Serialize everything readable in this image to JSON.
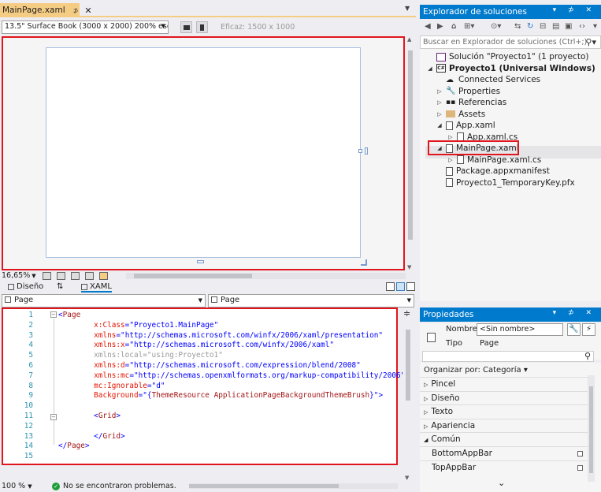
{
  "document_tab": {
    "title": "MainPage.xaml",
    "pin_glyph": "⊅",
    "close_glyph": "✕"
  },
  "designer_toolbar": {
    "device": "13.5\" Surface Book (3000 x 2000) 200% escala",
    "effective_size": "Eficaz: 1500 x 1000"
  },
  "zoom": {
    "designer_zoom": "16,65%"
  },
  "split_tabs": {
    "design_label": "Diseño",
    "swap_label": "⇅",
    "xaml_label": "XAML"
  },
  "nav": {
    "left_scope": "Page",
    "right_scope": "Page"
  },
  "code": {
    "lines": [
      {
        "n": "1",
        "parts": [
          [
            "brk",
            "<"
          ],
          [
            "tag",
            "Page"
          ]
        ]
      },
      {
        "n": "2",
        "parts": [
          [
            "txt",
            "        "
          ],
          [
            "attr",
            "x:Class"
          ],
          [
            "brk",
            "="
          ],
          [
            "str",
            "\"Proyecto1.MainPage\""
          ]
        ]
      },
      {
        "n": "3",
        "parts": [
          [
            "txt",
            "        "
          ],
          [
            "attr",
            "xmlns"
          ],
          [
            "brk",
            "="
          ],
          [
            "str",
            "\"http://schemas.microsoft.com/winfx/2006/xaml/presentation\""
          ]
        ]
      },
      {
        "n": "4",
        "parts": [
          [
            "txt",
            "        "
          ],
          [
            "attr",
            "xmlns:x"
          ],
          [
            "brk",
            "="
          ],
          [
            "str",
            "\"http://schemas.microsoft.com/winfx/2006/xaml\""
          ]
        ]
      },
      {
        "n": "5",
        "parts": [
          [
            "txt",
            "        "
          ],
          [
            "ign",
            "xmlns:local=\"using:Proyecto1\""
          ]
        ]
      },
      {
        "n": "6",
        "parts": [
          [
            "txt",
            "        "
          ],
          [
            "attr",
            "xmlns:d"
          ],
          [
            "brk",
            "="
          ],
          [
            "str",
            "\"http://schemas.microsoft.com/expression/blend/2008\""
          ]
        ]
      },
      {
        "n": "7",
        "parts": [
          [
            "txt",
            "        "
          ],
          [
            "attr",
            "xmlns:mc"
          ],
          [
            "brk",
            "="
          ],
          [
            "str",
            "\"http://schemas.openxmlformats.org/markup-compatibility/2006\""
          ]
        ]
      },
      {
        "n": "8",
        "parts": [
          [
            "txt",
            "        "
          ],
          [
            "attr",
            "mc:Ignorable"
          ],
          [
            "brk",
            "="
          ],
          [
            "str",
            "\"d\""
          ]
        ]
      },
      {
        "n": "9",
        "parts": [
          [
            "txt",
            "        "
          ],
          [
            "attr",
            "Background"
          ],
          [
            "brk",
            "="
          ],
          [
            "str",
            "\"{"
          ],
          [
            "ext",
            "ThemeResource ApplicationPageBackgroundThemeBrush"
          ],
          [
            "str",
            "}\""
          ],
          [
            "brk",
            ">"
          ]
        ]
      },
      {
        "n": "10",
        "parts": []
      },
      {
        "n": "11",
        "parts": [
          [
            "txt",
            "        "
          ],
          [
            "brk",
            "<"
          ],
          [
            "tag",
            "Grid"
          ],
          [
            "brk",
            ">"
          ]
        ]
      },
      {
        "n": "12",
        "parts": []
      },
      {
        "n": "13",
        "parts": [
          [
            "txt",
            "        "
          ],
          [
            "brk",
            "</"
          ],
          [
            "tag",
            "Grid"
          ],
          [
            "brk",
            ">"
          ]
        ]
      },
      {
        "n": "14",
        "parts": [
          [
            "brk",
            "</"
          ],
          [
            "tag",
            "Page"
          ],
          [
            "brk",
            ">"
          ]
        ]
      },
      {
        "n": "15",
        "parts": []
      }
    ]
  },
  "status": {
    "zoom": "100 %",
    "message": "No se encontraron problemas."
  },
  "solution_explorer": {
    "title": "Explorador de soluciones",
    "title_controls": "▾ ⊅ ✕",
    "search_placeholder": "Buscar en Explorador de soluciones (Ctrl+;)",
    "tree": [
      {
        "label": "Solución \"Proyecto1\"  (1 proyecto)",
        "indent": 0,
        "exp": "",
        "icon": "sol",
        "bold": false
      },
      {
        "label": "Proyecto1 (Universal Windows)",
        "indent": 1,
        "exp": "◢",
        "icon": "proj",
        "bold": true
      },
      {
        "label": "Connected Services",
        "indent": 2,
        "exp": "",
        "icon": "cloud",
        "bold": false
      },
      {
        "label": "Properties",
        "indent": 2,
        "exp": "▷",
        "icon": "wrench",
        "bold": false
      },
      {
        "label": "Referencias",
        "indent": 2,
        "exp": "▷",
        "icon": "ref",
        "bold": false
      },
      {
        "label": "Assets",
        "indent": 2,
        "exp": "▷",
        "icon": "folder",
        "bold": false
      },
      {
        "label": "App.xaml",
        "indent": 2,
        "exp": "◢",
        "icon": "file",
        "bold": false
      },
      {
        "label": "App.xaml.cs",
        "indent": 3,
        "exp": "▷",
        "icon": "file",
        "bold": false
      },
      {
        "label": "MainPage.xaml",
        "indent": 2,
        "exp": "◢",
        "icon": "file",
        "bold": false
      },
      {
        "label": "MainPage.xaml.cs",
        "indent": 3,
        "exp": "▷",
        "icon": "file",
        "bold": false
      },
      {
        "label": "Package.appxmanifest",
        "indent": 2,
        "exp": "",
        "icon": "file",
        "bold": false
      },
      {
        "label": "Proyecto1_TemporaryKey.pfx",
        "indent": 2,
        "exp": "",
        "icon": "file",
        "bold": false
      }
    ]
  },
  "properties": {
    "title": "Propiedades",
    "title_controls": "▾ ⊅ ✕",
    "name_label": "Nombre",
    "name_value": "<Sin nombre>",
    "type_label": "Tipo",
    "type_value": "Page",
    "arrange_by": "Organizar por: Categoría ▾",
    "rows": [
      {
        "label": "Pincel",
        "exp": "▷",
        "check": false
      },
      {
        "label": "Diseño",
        "exp": "▷",
        "check": false
      },
      {
        "label": "Texto",
        "exp": "▷",
        "check": false
      },
      {
        "label": "Apariencia",
        "exp": "▷",
        "check": false
      },
      {
        "label": "Común",
        "exp": "◢",
        "check": false
      },
      {
        "label": "BottomAppBar",
        "exp": "",
        "check": true
      },
      {
        "label": "TopAppBar",
        "exp": "",
        "check": true
      }
    ]
  },
  "colors": {
    "accent": "#007acc",
    "tab_active": "#f5cc84",
    "highlight": "#e0151d"
  }
}
